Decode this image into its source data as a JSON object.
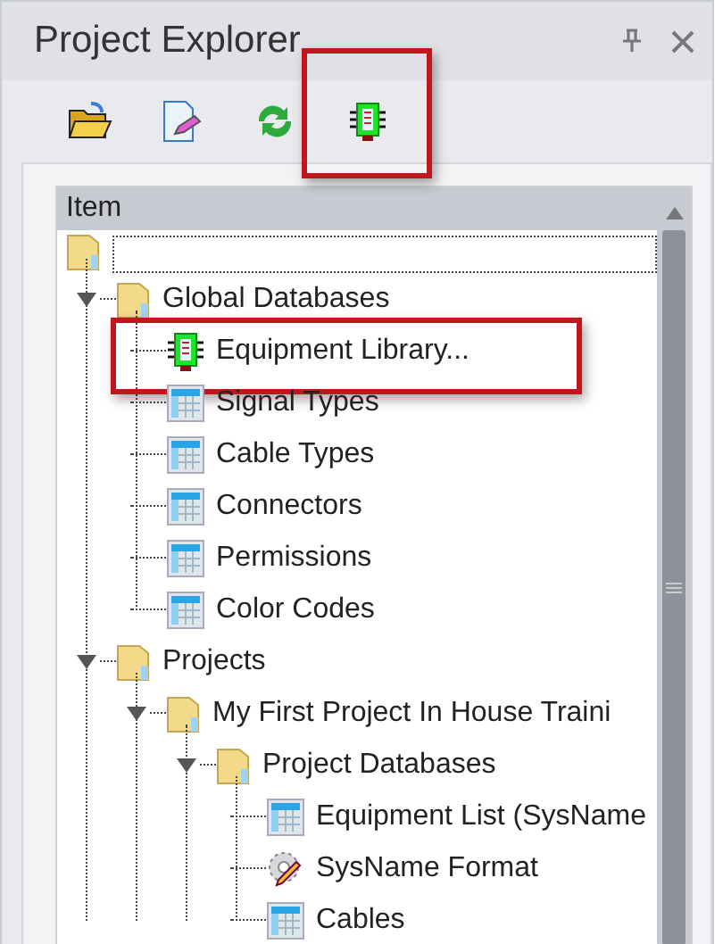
{
  "panel": {
    "title": "Project Explorer"
  },
  "toolbar": [
    {
      "kind": "open"
    },
    {
      "kind": "edit"
    },
    {
      "kind": "refresh"
    },
    {
      "kind": "chip",
      "highlighted": true
    }
  ],
  "tree": {
    "column": "Item",
    "items": [
      {
        "kind": "folder",
        "focused": true,
        "expanded": true,
        "children": [
          {
            "kind": "folder",
            "label": "Global Databases",
            "expanded": true,
            "children": [
              {
                "kind": "chip",
                "label": "Equipment Library...",
                "highlighted": true
              },
              {
                "kind": "table",
                "label": "Signal Types"
              },
              {
                "kind": "table",
                "label": "Cable Types"
              },
              {
                "kind": "table",
                "label": "Connectors"
              },
              {
                "kind": "table",
                "label": "Permissions"
              },
              {
                "kind": "table",
                "label": "Color Codes"
              }
            ]
          },
          {
            "kind": "folder",
            "label": "Projects",
            "expanded": true,
            "children": [
              {
                "kind": "folder",
                "label": "My First Project In House Traini",
                "expanded": true,
                "children": [
                  {
                    "kind": "folder",
                    "label": "Project Databases",
                    "expanded": true,
                    "children": [
                      {
                        "kind": "table",
                        "label": "Equipment List (SysName"
                      },
                      {
                        "kind": "format",
                        "label": "SysName Format"
                      },
                      {
                        "kind": "table",
                        "label": "Cables"
                      }
                    ]
                  }
                ]
              }
            ]
          }
        ]
      }
    ]
  }
}
